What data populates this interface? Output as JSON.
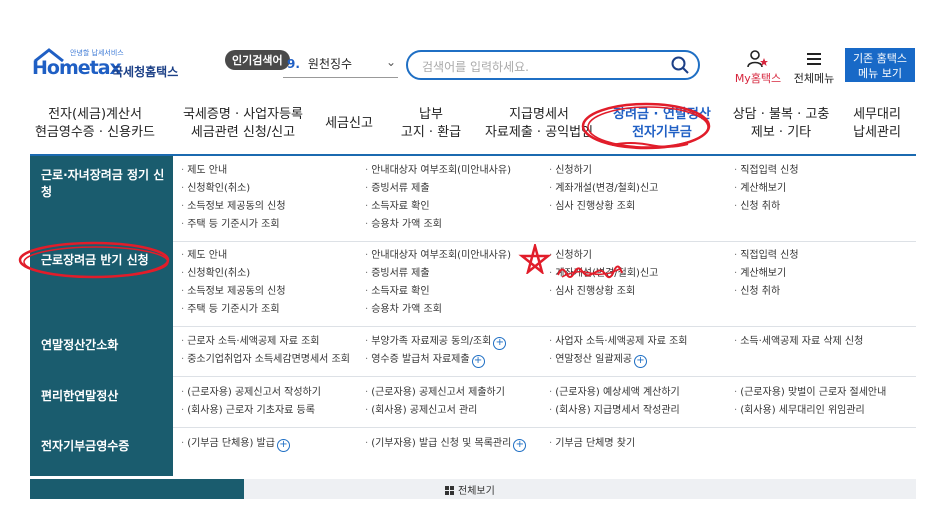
{
  "header": {
    "logo_sub": "안녕할 납세서비스",
    "logo_word": "Hometax",
    "logo_kr": "국세청홈택스",
    "popular_badge": "인기검색어",
    "rank_num": "9.",
    "rank_term": "원천징수",
    "search_placeholder": "검색어를 입력하세요.",
    "my_home": "My홈택스",
    "all_menu": "전체메뉴",
    "old_hometax_line1": "기존 홈택스",
    "old_hometax_line2": "메뉴 보기"
  },
  "nav": [
    {
      "l1": "전자(세금)계산서",
      "l2": "현금영수증 · 신용카드"
    },
    {
      "l1": "국세증명 · 사업자등록",
      "l2": "세금관련 신청/신고"
    },
    {
      "l1": "세금신고",
      "l2": ""
    },
    {
      "l1": "납부",
      "l2": "고지 · 환급"
    },
    {
      "l1": "지급명세서",
      "l2": "자료제출 · 공익법인"
    },
    {
      "l1": "장려금 · 연말정산",
      "l2": "전자기부금"
    },
    {
      "l1": "상담 · 불복 · 고충",
      "l2": "제보 · 기타"
    },
    {
      "l1": "세무대리",
      "l2": "납세관리"
    }
  ],
  "categories": [
    "근로·자녀장려금 정기 신청",
    "근로장려금 반기 신청",
    "연말정산간소화",
    "편리한연말정산",
    "전자기부금영수증"
  ],
  "sections": [
    {
      "cols": [
        [
          "제도 안내",
          "신청확인(취소)",
          "소득정보 제공동의 신청",
          "주택 등 기준시가 조회"
        ],
        [
          "안내대상자 여부조회(미안내사유)",
          "증빙서류 제출",
          "소득자료 확인",
          "승용차 가액 조회"
        ],
        [
          "신청하기",
          "계좌개설(변경/철회)신고",
          "심사 진행상황 조회"
        ],
        [
          "직접입력 신청",
          "계산해보기",
          "신청 취하"
        ]
      ]
    },
    {
      "cols": [
        [
          "제도 안내",
          "신청확인(취소)",
          "소득정보 제공동의 신청",
          "주택 등 기준시가 조회"
        ],
        [
          "안내대상자 여부조회(미안내사유)",
          "증빙서류 제출",
          "소득자료 확인",
          "승용차 가액 조회"
        ],
        [
          "신청하기",
          "계좌개설(변경/철회)신고",
          "심사 진행상황 조회"
        ],
        [
          "직접입력 신청",
          "계산해보기",
          "신청 취하"
        ]
      ]
    },
    {
      "cols": [
        [
          "근로자 소득·세액공제 자료 조회",
          "중소기업취업자 소득세감면명세서 조회"
        ],
        [
          "부양가족 자료제공 동의/조회",
          "영수증 발급처 자료제출"
        ],
        [
          "사업자 소득·세액공제 자료 조회",
          "연말정산 일괄제공"
        ],
        [
          "소득·세액공제 자료 삭제 신청"
        ]
      ]
    },
    {
      "cols": [
        [
          "(근로자용) 공제신고서 작성하기",
          "(회사용) 근로자 기초자료 등록"
        ],
        [
          "(근로자용) 공제신고서 제출하기",
          "(회사용) 공제신고서 관리"
        ],
        [
          "(근로자용) 예상세액 계산하기",
          "(회사용) 지급명세서 작성관리"
        ],
        [
          "(근로자용) 맞벌이 근로자 절세안내",
          "(회사용) 세무대리인 위임관리"
        ]
      ]
    },
    {
      "cols": [
        [
          "(기부금 단체용) 발급"
        ],
        [
          "(기부자용) 발급 신청 및 목록관리"
        ],
        [
          "기부금 단체명 찾기"
        ],
        []
      ]
    }
  ],
  "view_all": "전체보기",
  "colors": {
    "brand_blue": "#1f5fc4",
    "panel_teal": "#1a5c6e",
    "annotation_red": "#e11d2a"
  }
}
